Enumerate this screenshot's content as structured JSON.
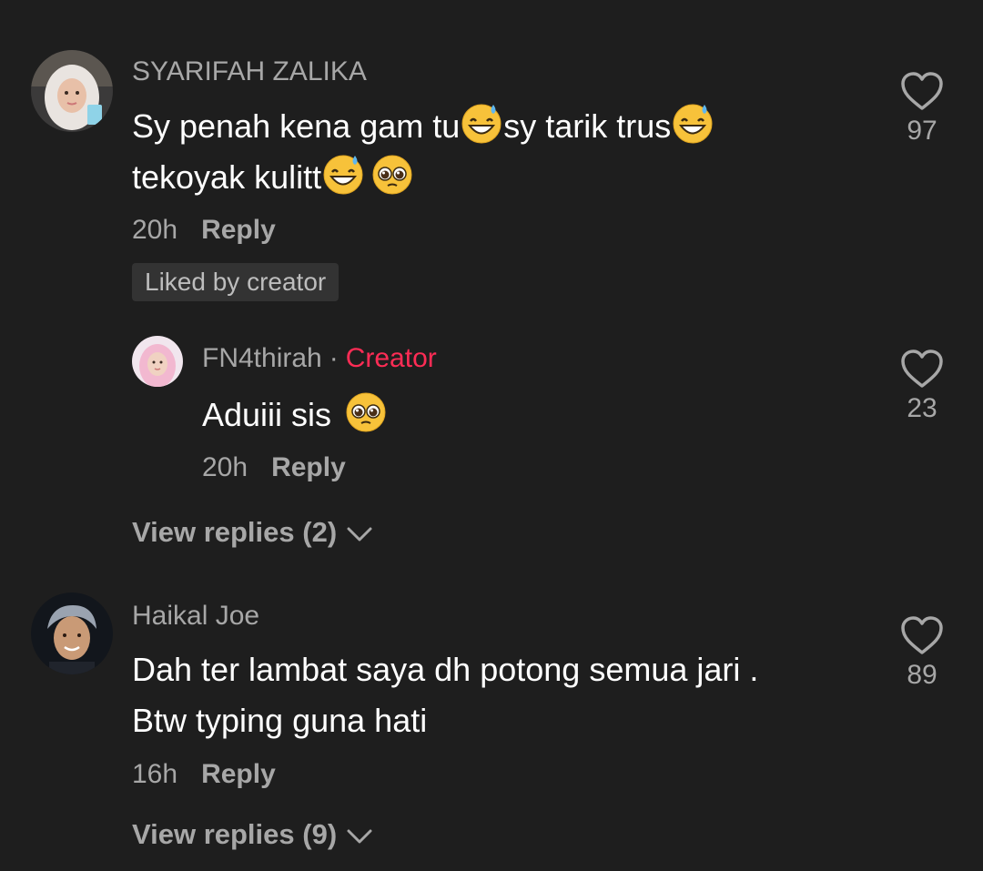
{
  "comments": [
    {
      "username": "SYARIFAH ZALIKA",
      "text_line1_a": "Sy penah kena gam tu",
      "text_line1_b": "sy tarik trus",
      "text_line2": "tekoyak kulitt",
      "time": "20h",
      "reply_label": "Reply",
      "badge": "Liked by creator",
      "likes": "97",
      "avatar": "hijab-woman-avatar"
    },
    {
      "username": "FN4thirah",
      "separator": "·",
      "role": "Creator",
      "text": "Aduiii sis",
      "time": "20h",
      "reply_label": "Reply",
      "likes": "23",
      "avatar": "pink-hijab-avatar"
    },
    {
      "view_replies": "View replies (2)"
    },
    {
      "username": "Haikal Joe",
      "text_line1": "Dah ter lambat saya dh potong semua jari .",
      "text_line2": "Btw typing guna hati",
      "time": "16h",
      "reply_label": "Reply",
      "likes": "89",
      "avatar": "man-avatar",
      "view_replies": "View replies (9)"
    }
  ],
  "icons": {
    "like": "heart-outline-icon",
    "expand": "chevron-down-icon",
    "emoji_sweat": "grinning-face-with-sweat-emoji",
    "emoji_pleading": "pleading-face-emoji"
  },
  "colors": {
    "background": "#1e1e1e",
    "creator_accent": "#fe2c55",
    "muted": "#a7a7a7"
  }
}
